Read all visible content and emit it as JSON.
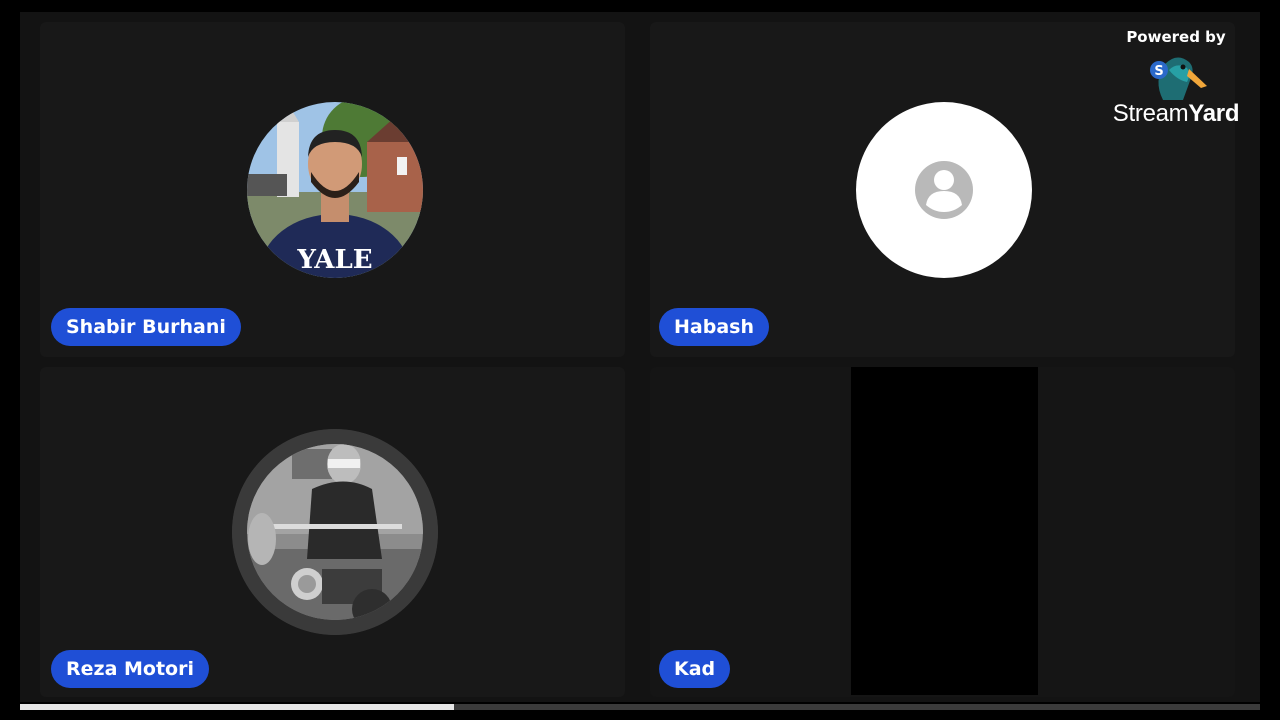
{
  "branding": {
    "powered_by": "Powered by",
    "logo_icon": "streamyard-duck-icon",
    "name_part1": "Stream",
    "name_part2": "Yard"
  },
  "participants": [
    {
      "name": "Shabir Burhani",
      "avatar": "photo"
    },
    {
      "name": "Habash",
      "avatar": "default-user-icon"
    },
    {
      "name": "Reza Motori",
      "avatar": "photo-bw"
    },
    {
      "name": "Kad",
      "avatar": "video-black"
    }
  ],
  "colors": {
    "name_tag": "#1f4fd6",
    "stage_bg": "#131313",
    "tile_bg": "#181818"
  },
  "playback": {
    "progress": 0.35
  }
}
